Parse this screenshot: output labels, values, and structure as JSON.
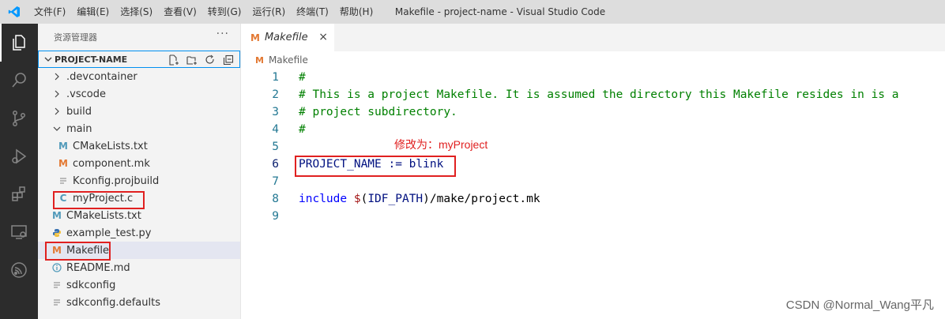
{
  "titlebar": {
    "menu": [
      "文件(F)",
      "编辑(E)",
      "选择(S)",
      "查看(V)",
      "转到(G)",
      "运行(R)",
      "终端(T)",
      "帮助(H)"
    ],
    "window_title": "Makefile - project-name - Visual Studio Code"
  },
  "activitybar": {
    "icons": [
      "explorer-icon",
      "search-icon",
      "source-control-icon",
      "run-debug-icon",
      "extensions-icon",
      "remote-explorer-icon",
      "esp-idf-icon"
    ]
  },
  "sidebar": {
    "title": "资源管理器",
    "more": "···",
    "project_name": "PROJECT-NAME",
    "items": [
      {
        "label": ".devcontainer",
        "type": "folder-collapsed",
        "depth": 1
      },
      {
        "label": ".vscode",
        "type": "folder-collapsed",
        "depth": 1
      },
      {
        "label": "build",
        "type": "folder-collapsed",
        "depth": 1
      },
      {
        "label": "main",
        "type": "folder-expanded",
        "depth": 1
      },
      {
        "label": "CMakeLists.txt",
        "type": "cmake",
        "depth": 2
      },
      {
        "label": "component.mk",
        "type": "make",
        "depth": 2
      },
      {
        "label": "Kconfig.projbuild",
        "type": "text",
        "depth": 2
      },
      {
        "label": "myProject.c",
        "type": "c",
        "depth": 2
      },
      {
        "label": "CMakeLists.txt",
        "type": "cmake",
        "depth": 1
      },
      {
        "label": "example_test.py",
        "type": "python",
        "depth": 1
      },
      {
        "label": "Makefile",
        "type": "make",
        "depth": 1
      },
      {
        "label": "README.md",
        "type": "info",
        "depth": 1
      },
      {
        "label": "sdkconfig",
        "type": "text",
        "depth": 1
      },
      {
        "label": "sdkconfig.defaults",
        "type": "text",
        "depth": 1
      }
    ]
  },
  "editor": {
    "tab_icon": "M",
    "tab_label": "Makefile",
    "tab_close": "×",
    "breadcrumb": "Makefile",
    "lines": [
      {
        "n": "1",
        "text": "#"
      },
      {
        "n": "2",
        "text": "# This is a project Makefile. It is assumed the directory this Makefile resides in is a"
      },
      {
        "n": "3",
        "text": "# project subdirectory."
      },
      {
        "n": "4",
        "text": "#"
      },
      {
        "n": "5",
        "text": ""
      },
      {
        "n": "6",
        "text": "PROJECT_NAME := blink"
      },
      {
        "n": "7",
        "text": ""
      },
      {
        "n": "8",
        "text": "include $(IDF_PATH)/make/project.mk"
      },
      {
        "n": "9",
        "text": ""
      }
    ],
    "annotation": "修改为：myProject"
  },
  "watermark": "CSDN @Normal_Wang平凡",
  "colors": {
    "accent": "#007acc",
    "highlight_box": "#e02020",
    "comment": "#008000",
    "keyword": "#0000ff"
  }
}
